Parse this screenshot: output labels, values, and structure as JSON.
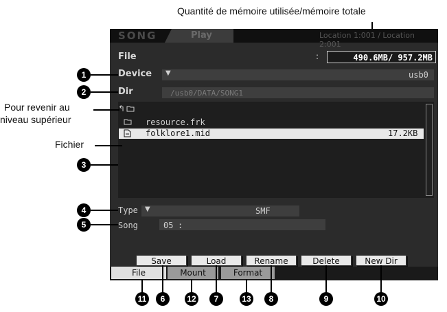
{
  "annotations": {
    "memory": "Quantité de mémoire utilisée/mémoire totale",
    "parent_line1": "Pour revenir au",
    "parent_line2": "niveau supérieur",
    "file": "Fichier"
  },
  "header": {
    "mode": "SONG",
    "tab": "Play",
    "location": "Location 1:001 / Location 2:001"
  },
  "file_section": {
    "title": "File",
    "colon": ":",
    "memory": "490.6MB/ 957.2MB"
  },
  "device": {
    "label": "Device",
    "arrow": "▼",
    "value": "usb0"
  },
  "dir": {
    "label": "Dir",
    "path": "/usb0/DATA/SONG1"
  },
  "list": {
    "parent_symbol": "↰",
    "items": [
      {
        "name": "resource.frk",
        "size": "",
        "type": "folder"
      },
      {
        "name": "folklore1.mid",
        "size": "17.2KB",
        "type": "file"
      }
    ]
  },
  "type": {
    "label": "Type",
    "arrow": "▼",
    "value": "SMF"
  },
  "song": {
    "label": "Song",
    "number": "05",
    "colon": ":",
    "name": ""
  },
  "buttons": {
    "save": "Save",
    "load": "Load",
    "rename": "Rename",
    "delete": "Delete",
    "newdir": "New Dir"
  },
  "tabs": {
    "file": "File",
    "mount": "Mount",
    "format": "Format"
  },
  "badges": [
    "1",
    "2",
    "3",
    "4",
    "5",
    "6",
    "7",
    "8",
    "9",
    "10",
    "11",
    "12",
    "13"
  ]
}
